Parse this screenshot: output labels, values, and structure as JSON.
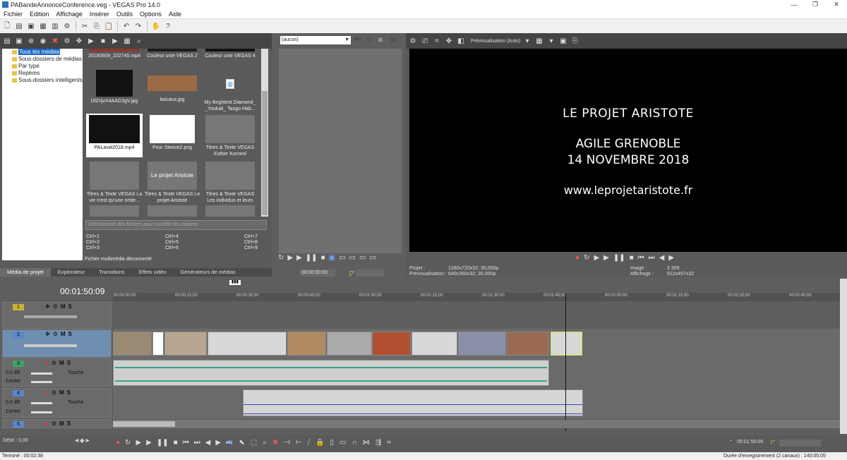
{
  "window": {
    "title": "PABandeAnnonceConference.veg - VEGAS Pro 14.0",
    "min": "—",
    "max": "❐",
    "close": "✕"
  },
  "menu": [
    "Fichier",
    "Edition",
    "Affichage",
    "Insérer",
    "Outils",
    "Options",
    "Aide"
  ],
  "media": {
    "tree": [
      "Tous les médias",
      "Sous-dossiers de médias",
      "Par type",
      "Repères",
      "Sous-dossiers intelligents"
    ],
    "thumbs": [
      {
        "caption": "20180609_222745.mp4"
      },
      {
        "caption": "Couleur unie VEGAS 2"
      },
      {
        "caption": "Couleur unie VEGAS 4"
      },
      {
        "caption": "DfZrijvX4AAG3gV.jpg"
      },
      {
        "caption": "lascaux.jpg"
      },
      {
        "caption": "My Brightest Diamond_ _Youkali_ Tango Hab..."
      },
      {
        "caption": "PALaval2018.mp4"
      },
      {
        "caption": "Pour Steeve2.png"
      },
      {
        "caption": "Titres & Texte VEGAS Esther Kornexl"
      },
      {
        "caption": "Titres & Texte VEGAS La vie n'est qu'une ombr..."
      },
      {
        "caption": "Titres & Texte VEGAS Le projet Aristote",
        "overlay": "Le projet Aristote"
      },
      {
        "caption": "Titres & Texte VEGAS Les individus et leurs intera..."
      }
    ],
    "filter_placeholder": "Sélectionner des fichiers pour modifier les repères",
    "shortcuts": [
      "Ctrl+1",
      "Ctrl+4",
      "Ctrl+7",
      "Ctrl+2",
      "Ctrl+5",
      "Ctrl+8",
      "Ctrl+3",
      "Ctrl+6",
      "Ctrl+9"
    ],
    "offline": "Fichier multimédia déconnecté",
    "tabs": [
      "Média de projet",
      "Explorateur",
      "Transitions",
      "Effets vidéo",
      "Générateurs de médias"
    ]
  },
  "trimmer": {
    "select_value": "(aucun)",
    "time": "00:00:00:00"
  },
  "preview": {
    "mode": "Prévisualisation (Auto)",
    "lines": [
      "LE PROJET ARISTOTE",
      "AGILE GRENOBLE",
      "14 NOVEMBRE 2018",
      "www.leprojetaristote.fr"
    ],
    "project_label": "Projet :",
    "project_value": "1280x720x32; 30,000p",
    "preview_label": "Prévisualisation :",
    "preview_value": "640x360x32; 30,000p",
    "image_label": "Image :",
    "image_value": "3 309",
    "display_label": "Affichage :",
    "display_value": "812x457x32"
  },
  "timeline": {
    "timecode": "00:01:50:09",
    "ruler": [
      "00:00:00;00",
      "00:00:15;00",
      "00:00:30;00",
      "00:00:45;00",
      "00:01:00;00",
      "00:01:15;00",
      "00:01:30;00",
      "00:01:45;00",
      "00:02:00;00",
      "00:02:15;00",
      "00:02:30;00",
      "00:02:45;00"
    ],
    "tracks": [
      {
        "num": "1",
        "color": "#c9b23a"
      },
      {
        "num": "2",
        "color": "#5b86c9"
      },
      {
        "num": "3",
        "color": "#3fa26a",
        "db": "0,0 dB",
        "touch": "Touche",
        "center": "Centre"
      },
      {
        "num": "4",
        "color": "#5b86c9",
        "db": "0,0 dB",
        "touch": "Touche",
        "center": "Centre"
      },
      {
        "num": "5",
        "color": "#5b86c9"
      }
    ],
    "rate": "Débit : 0,00",
    "end_time": "00:01:50:09"
  },
  "status": {
    "left": "Terminé : 00:02:38",
    "right": "Durée d'enregistrement (2 canaux) : 140:05:05"
  }
}
